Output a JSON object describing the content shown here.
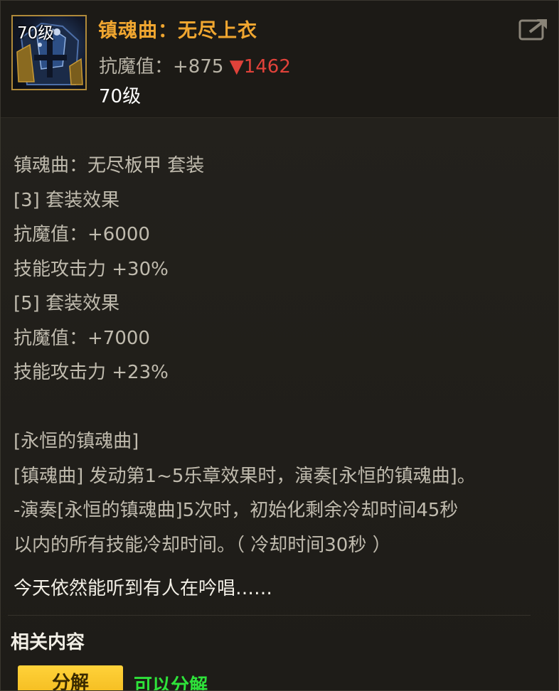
{
  "item": {
    "icon_level": "70级",
    "name": "镇魂曲：无尽上衣",
    "stat_label": "抗魔值：+875 ",
    "stat_diff_arrow": "▼",
    "stat_diff_value": "1462",
    "level": "70级",
    "rarity_color": "#f0a630",
    "icon_name": "armor-chestplate-icon"
  },
  "share": {
    "icon_name": "share-icon"
  },
  "description": {
    "lines": [
      "镇魂曲：无尽板甲 套装",
      "[3] 套装效果",
      "抗魔值：+6000",
      "技能攻击力 +30%",
      "[5] 套装效果",
      "抗魔值：+7000",
      "技能攻击力 +23%",
      "",
      "[永恒的镇魂曲]",
      "[镇魂曲] 发动第1~5乐章效果时，演奏[永恒的镇魂曲]。",
      "-演奏[永恒的镇魂曲]5次时，初始化剩余冷却时间45秒",
      "以内的所有技能冷却时间。（ 冷却时间30秒 ）"
    ]
  },
  "flavor_text": "今天依然能听到有人在吟唱……",
  "related": {
    "title": "相关内容",
    "disassemble_button": "分解",
    "disassemble_status": "可以分解",
    "status_color": "#2ee23a"
  }
}
